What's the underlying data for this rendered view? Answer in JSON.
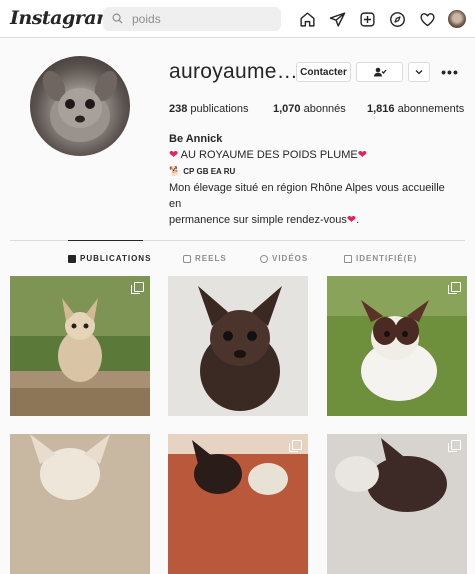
{
  "header": {
    "logo": "Instagram",
    "search_value": "poids",
    "icons": [
      "home-icon",
      "direct-icon",
      "new-post-icon",
      "explore-icon",
      "activity-icon",
      "profile-avatar"
    ]
  },
  "profile": {
    "username": "auroyaume…",
    "contact_label": "Contacter",
    "stats": {
      "publications": "238",
      "publications_label": " publications",
      "followers": "1,070",
      "followers_label": " abonnés",
      "following": "1,816",
      "following_label": " abonnements"
    },
    "bio": {
      "name": "Be Annick",
      "line1": "AU ROYAUME DES POIDS PLUME",
      "line2": "CP GB EA RU",
      "line3": "Mon élevage situé en région Rhône Alpes vous accueille en",
      "line4": "permanence sur simple rendez-vous",
      "line4_end": "."
    }
  },
  "tabs": [
    {
      "label": "PUBLICATIONS",
      "active": true
    },
    {
      "label": "REELS",
      "active": false
    },
    {
      "label": "VIDÉOS",
      "active": false
    },
    {
      "label": "IDENTIFIÉ(E)",
      "active": false
    }
  ],
  "colors": {
    "heart": "#e0245e",
    "border": "#dbdbdb",
    "text": "#262626",
    "muted": "#8e8e8e"
  }
}
